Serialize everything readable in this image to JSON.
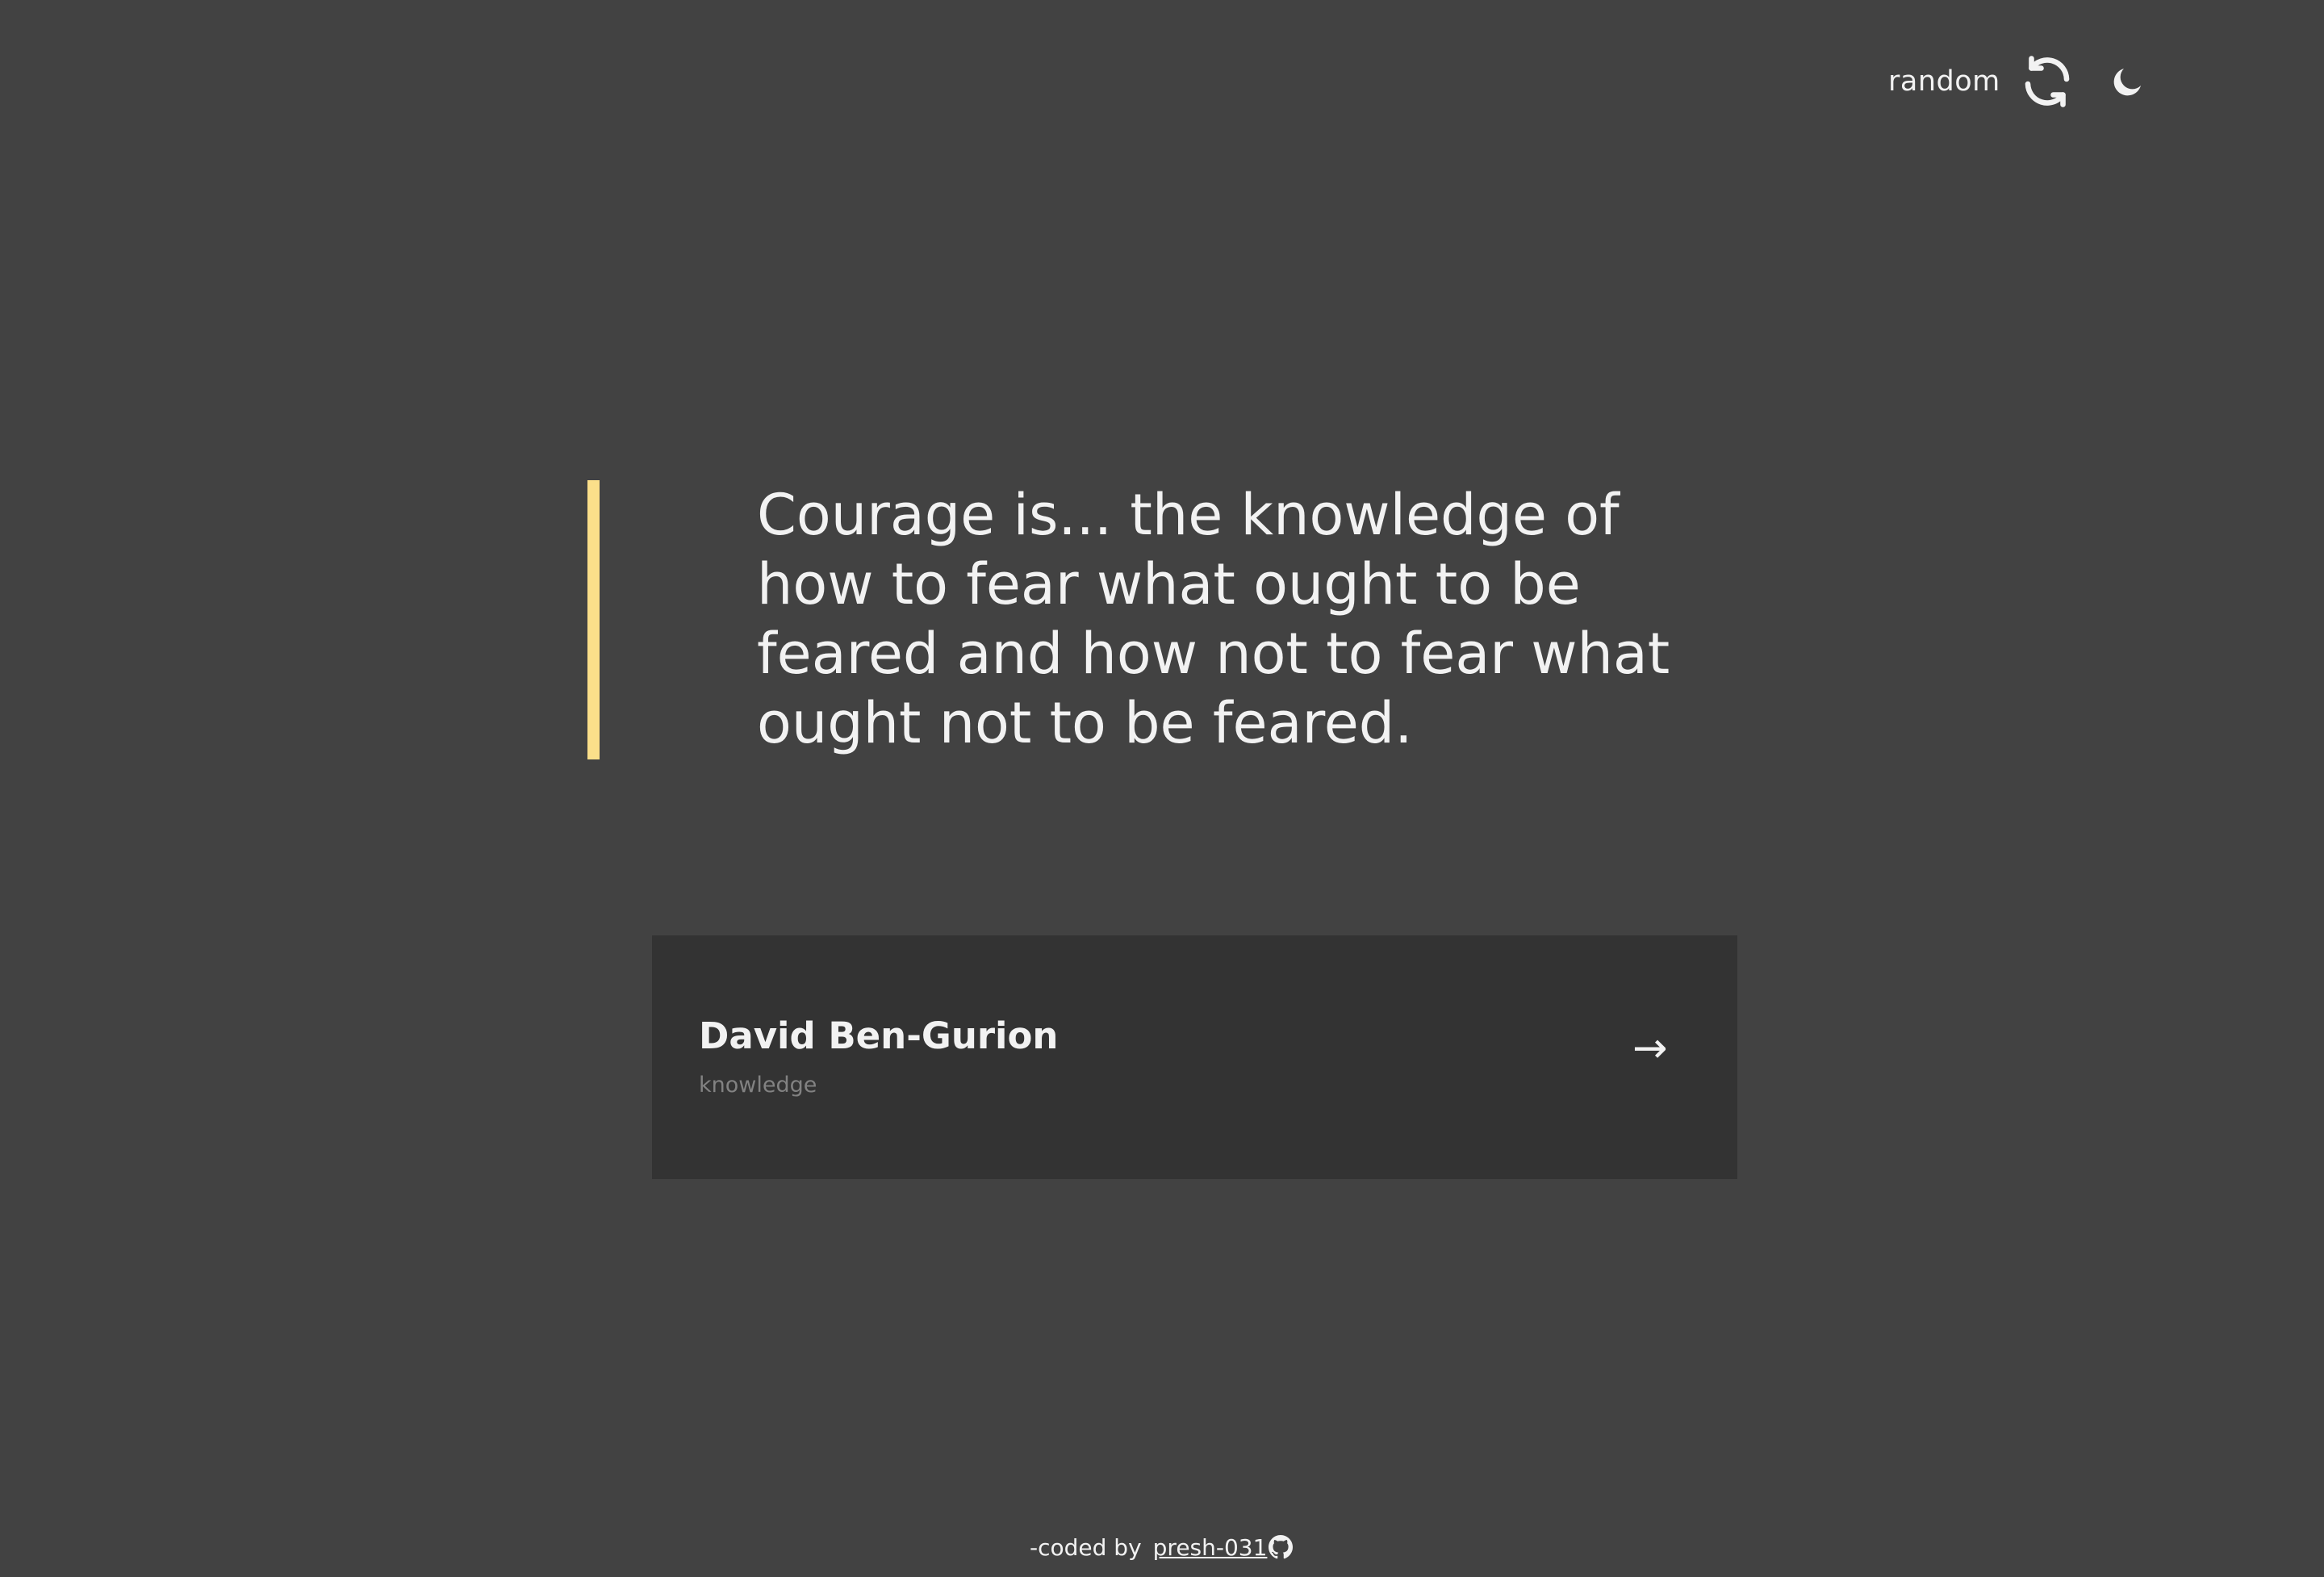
{
  "header": {
    "random_label": "random",
    "random_icon": "refresh-icon",
    "theme_icon": "moon-icon"
  },
  "quote": {
    "text": "Courage is... the knowledge of how to fear what ought to be feared and how not to fear what ought not to be feared.",
    "accent_color": "#fbdf8a"
  },
  "author_card": {
    "name": "David Ben-Gurion",
    "genre": "knowledge",
    "arrow": "→"
  },
  "footer": {
    "prefix": "-coded by",
    "link_text": "presh-031",
    "icon": "github-icon"
  },
  "colors": {
    "background": "#424242",
    "card_background": "#333333",
    "text": "#f2f2f2",
    "muted_text": "#828282"
  }
}
